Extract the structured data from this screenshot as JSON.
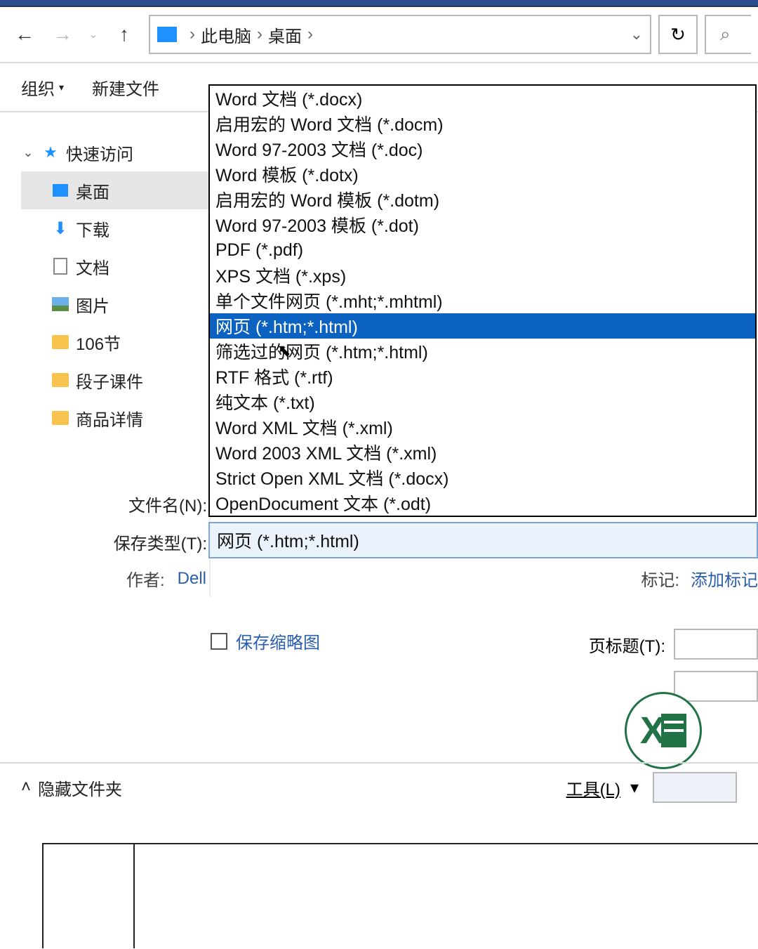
{
  "breadcrumb": {
    "pc": "此电脑",
    "desktop": "桌面"
  },
  "cmdbar": {
    "organize": "组织",
    "newfolder": "新建文件"
  },
  "tree": {
    "quick": "快速访问",
    "desktop": "桌面",
    "downloads": "下载",
    "documents": "文档",
    "pictures": "图片",
    "folder_106": "106节",
    "folder_duanzi": "段子课件",
    "folder_goods": "商品详情"
  },
  "fields": {
    "filename_label": "文件名(N):",
    "saveas_label": "保存类型(T):",
    "saveas_value": "网页 (*.htm;*.html)",
    "author_label": "作者:",
    "author_value": "Dell",
    "tags_label": "标记:",
    "tags_placeholder": "添加标记",
    "save_thumbnail": "保存缩略图",
    "page_title_label": "页标题(T):"
  },
  "filetypes": [
    "Word 文档 (*.docx)",
    "启用宏的 Word 文档 (*.docm)",
    "Word 97-2003 文档 (*.doc)",
    "Word 模板 (*.dotx)",
    "启用宏的 Word 模板 (*.dotm)",
    "Word 97-2003 模板 (*.dot)",
    "PDF (*.pdf)",
    "XPS 文档 (*.xps)",
    "单个文件网页 (*.mht;*.mhtml)",
    "网页 (*.htm;*.html)",
    "筛选过的网页 (*.htm;*.html)",
    "RTF 格式 (*.rtf)",
    "纯文本 (*.txt)",
    "Word XML 文档 (*.xml)",
    "Word 2003 XML 文档 (*.xml)",
    "Strict Open XML 文档 (*.docx)",
    "OpenDocument 文本 (*.odt)"
  ],
  "filetype_selected_index": 9,
  "footer": {
    "hide_folders": "隐藏文件夹",
    "tools": "工具(L)"
  }
}
